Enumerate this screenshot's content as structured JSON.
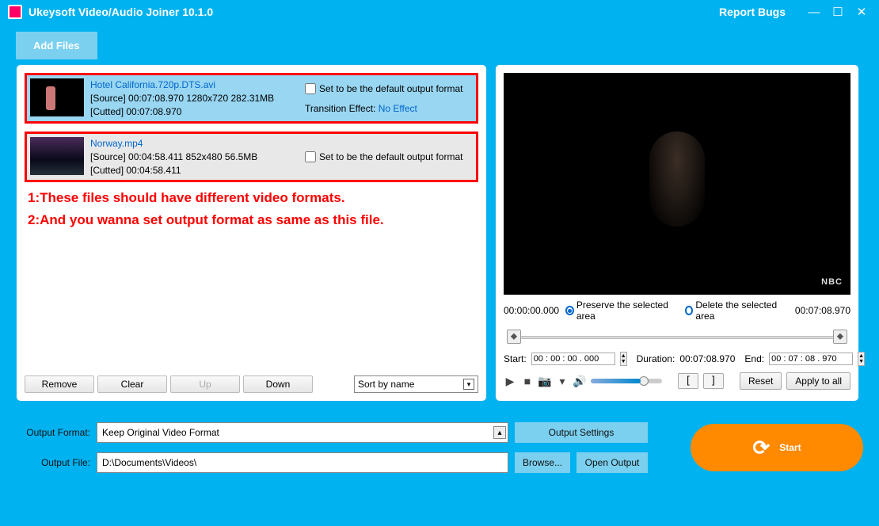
{
  "app": {
    "title": "Ukeysoft Video/Audio Joiner 10.1.0",
    "report": "Report Bugs"
  },
  "toolbar": {
    "add_files": "Add Files"
  },
  "files": [
    {
      "name": "Hotel California.720p.DTS.avi",
      "source": "[Source]  00:07:08.970  1280x720  282.31MB",
      "cutted": "[Cutted]  00:07:08.970",
      "default_label": "Set to be the default output format",
      "transition_label": "Transition Effect:",
      "transition_value": "No Effect",
      "marker": "1",
      "selected": true
    },
    {
      "name": "Norway.mp4",
      "source": "[Source]  00:04:58.411  852x480  56.5MB",
      "cutted": "[Cutted]  00:04:58.411",
      "default_label": "Set to be the default output format",
      "marker": "2",
      "selected": false
    }
  ],
  "annotations": {
    "line1": "1:These files should have different video formats.",
    "line2": "2:And you wanna set output format as same as this file."
  },
  "listbtns": {
    "remove": "Remove",
    "clear": "Clear",
    "up": "Up",
    "down": "Down",
    "sort": "Sort by name"
  },
  "preview": {
    "pos": "00:00:00.000",
    "end": "00:07:08.970",
    "preserve": "Preserve the selected area",
    "delete": "Delete the selected area",
    "start_label": "Start:",
    "start_value": "00 : 00 : 00 . 000",
    "duration_label": "Duration:",
    "duration_value": "00:07:08.970",
    "end_label": "End:",
    "end_value": "00 : 07 : 08 . 970",
    "reset": "Reset",
    "apply": "Apply to all",
    "nbc": "NBC"
  },
  "output": {
    "format_label": "Output Format:",
    "format_value": "Keep Original Video Format",
    "settings": "Output Settings",
    "file_label": "Output File:",
    "file_value": "D:\\Documents\\Videos\\",
    "browse": "Browse...",
    "open": "Open Output",
    "start": "Start"
  }
}
